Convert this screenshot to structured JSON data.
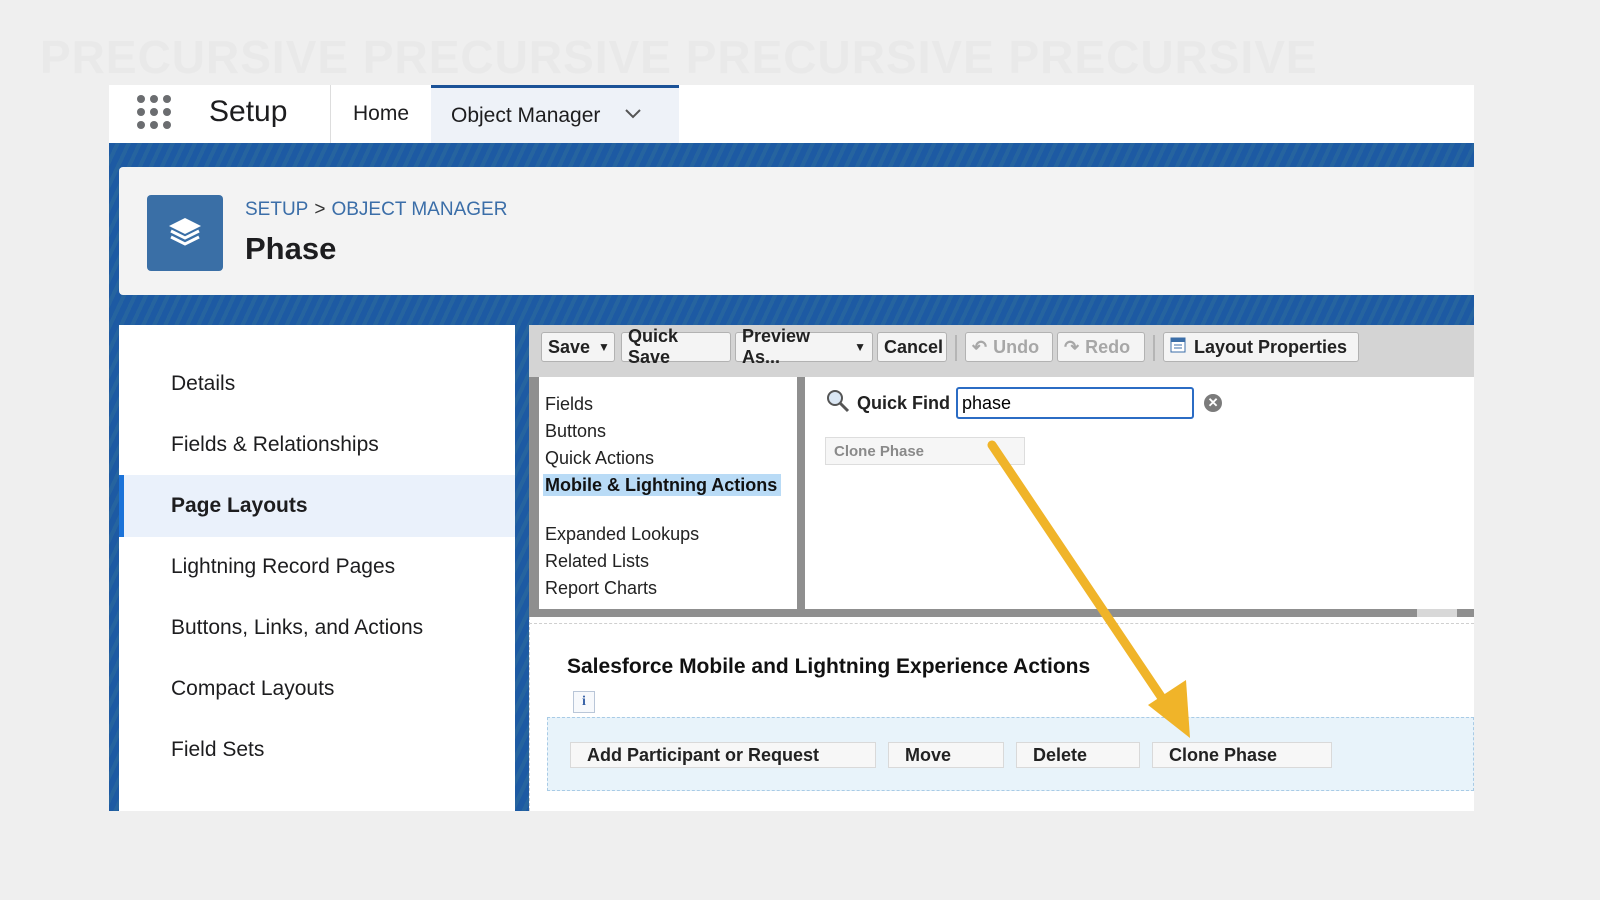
{
  "watermark": "PRECURSIVE   PRECURSIVE   PRECURSIVE   PRECURSIVE",
  "topnav": {
    "app_name": "Setup",
    "tabs": [
      {
        "label": "Home"
      },
      {
        "label": "Object Manager"
      }
    ]
  },
  "header": {
    "breadcrumb": {
      "root": "SETUP",
      "separator": ">",
      "current": "OBJECT MANAGER"
    },
    "title": "Phase"
  },
  "sidebar": {
    "items": [
      {
        "label": "Details"
      },
      {
        "label": "Fields & Relationships"
      },
      {
        "label": "Page Layouts",
        "active": true
      },
      {
        "label": "Lightning Record Pages"
      },
      {
        "label": "Buttons, Links, and Actions"
      },
      {
        "label": "Compact Layouts"
      },
      {
        "label": "Field Sets"
      }
    ]
  },
  "toolbar": {
    "save": "Save",
    "quick_save": "Quick Save",
    "preview_as": "Preview As...",
    "cancel": "Cancel",
    "undo": "Undo",
    "redo": "Redo",
    "layout_properties": "Layout Properties"
  },
  "palette": {
    "categories": [
      {
        "label": "Fields"
      },
      {
        "label": "Buttons"
      },
      {
        "label": "Quick Actions"
      },
      {
        "label": "Mobile & Lightning Actions",
        "selected": true
      },
      {
        "label": "Expanded Lookups"
      },
      {
        "label": "Related Lists"
      },
      {
        "label": "Report Charts"
      }
    ],
    "quick_find_label": "Quick Find",
    "quick_find_value": "phase",
    "result": "Clone Phase"
  },
  "section": {
    "title": "Salesforce Mobile and Lightning Experience Actions",
    "info_icon": "i",
    "actions": [
      {
        "label": "Add Participant or Request"
      },
      {
        "label": "Move"
      },
      {
        "label": "Delete"
      },
      {
        "label": "Clone Phase"
      }
    ]
  },
  "colors": {
    "brand_blue": "#1b5297",
    "link": "#3b6ea8",
    "active_bar": "#1b73d9",
    "arrow": "#f0b429"
  }
}
